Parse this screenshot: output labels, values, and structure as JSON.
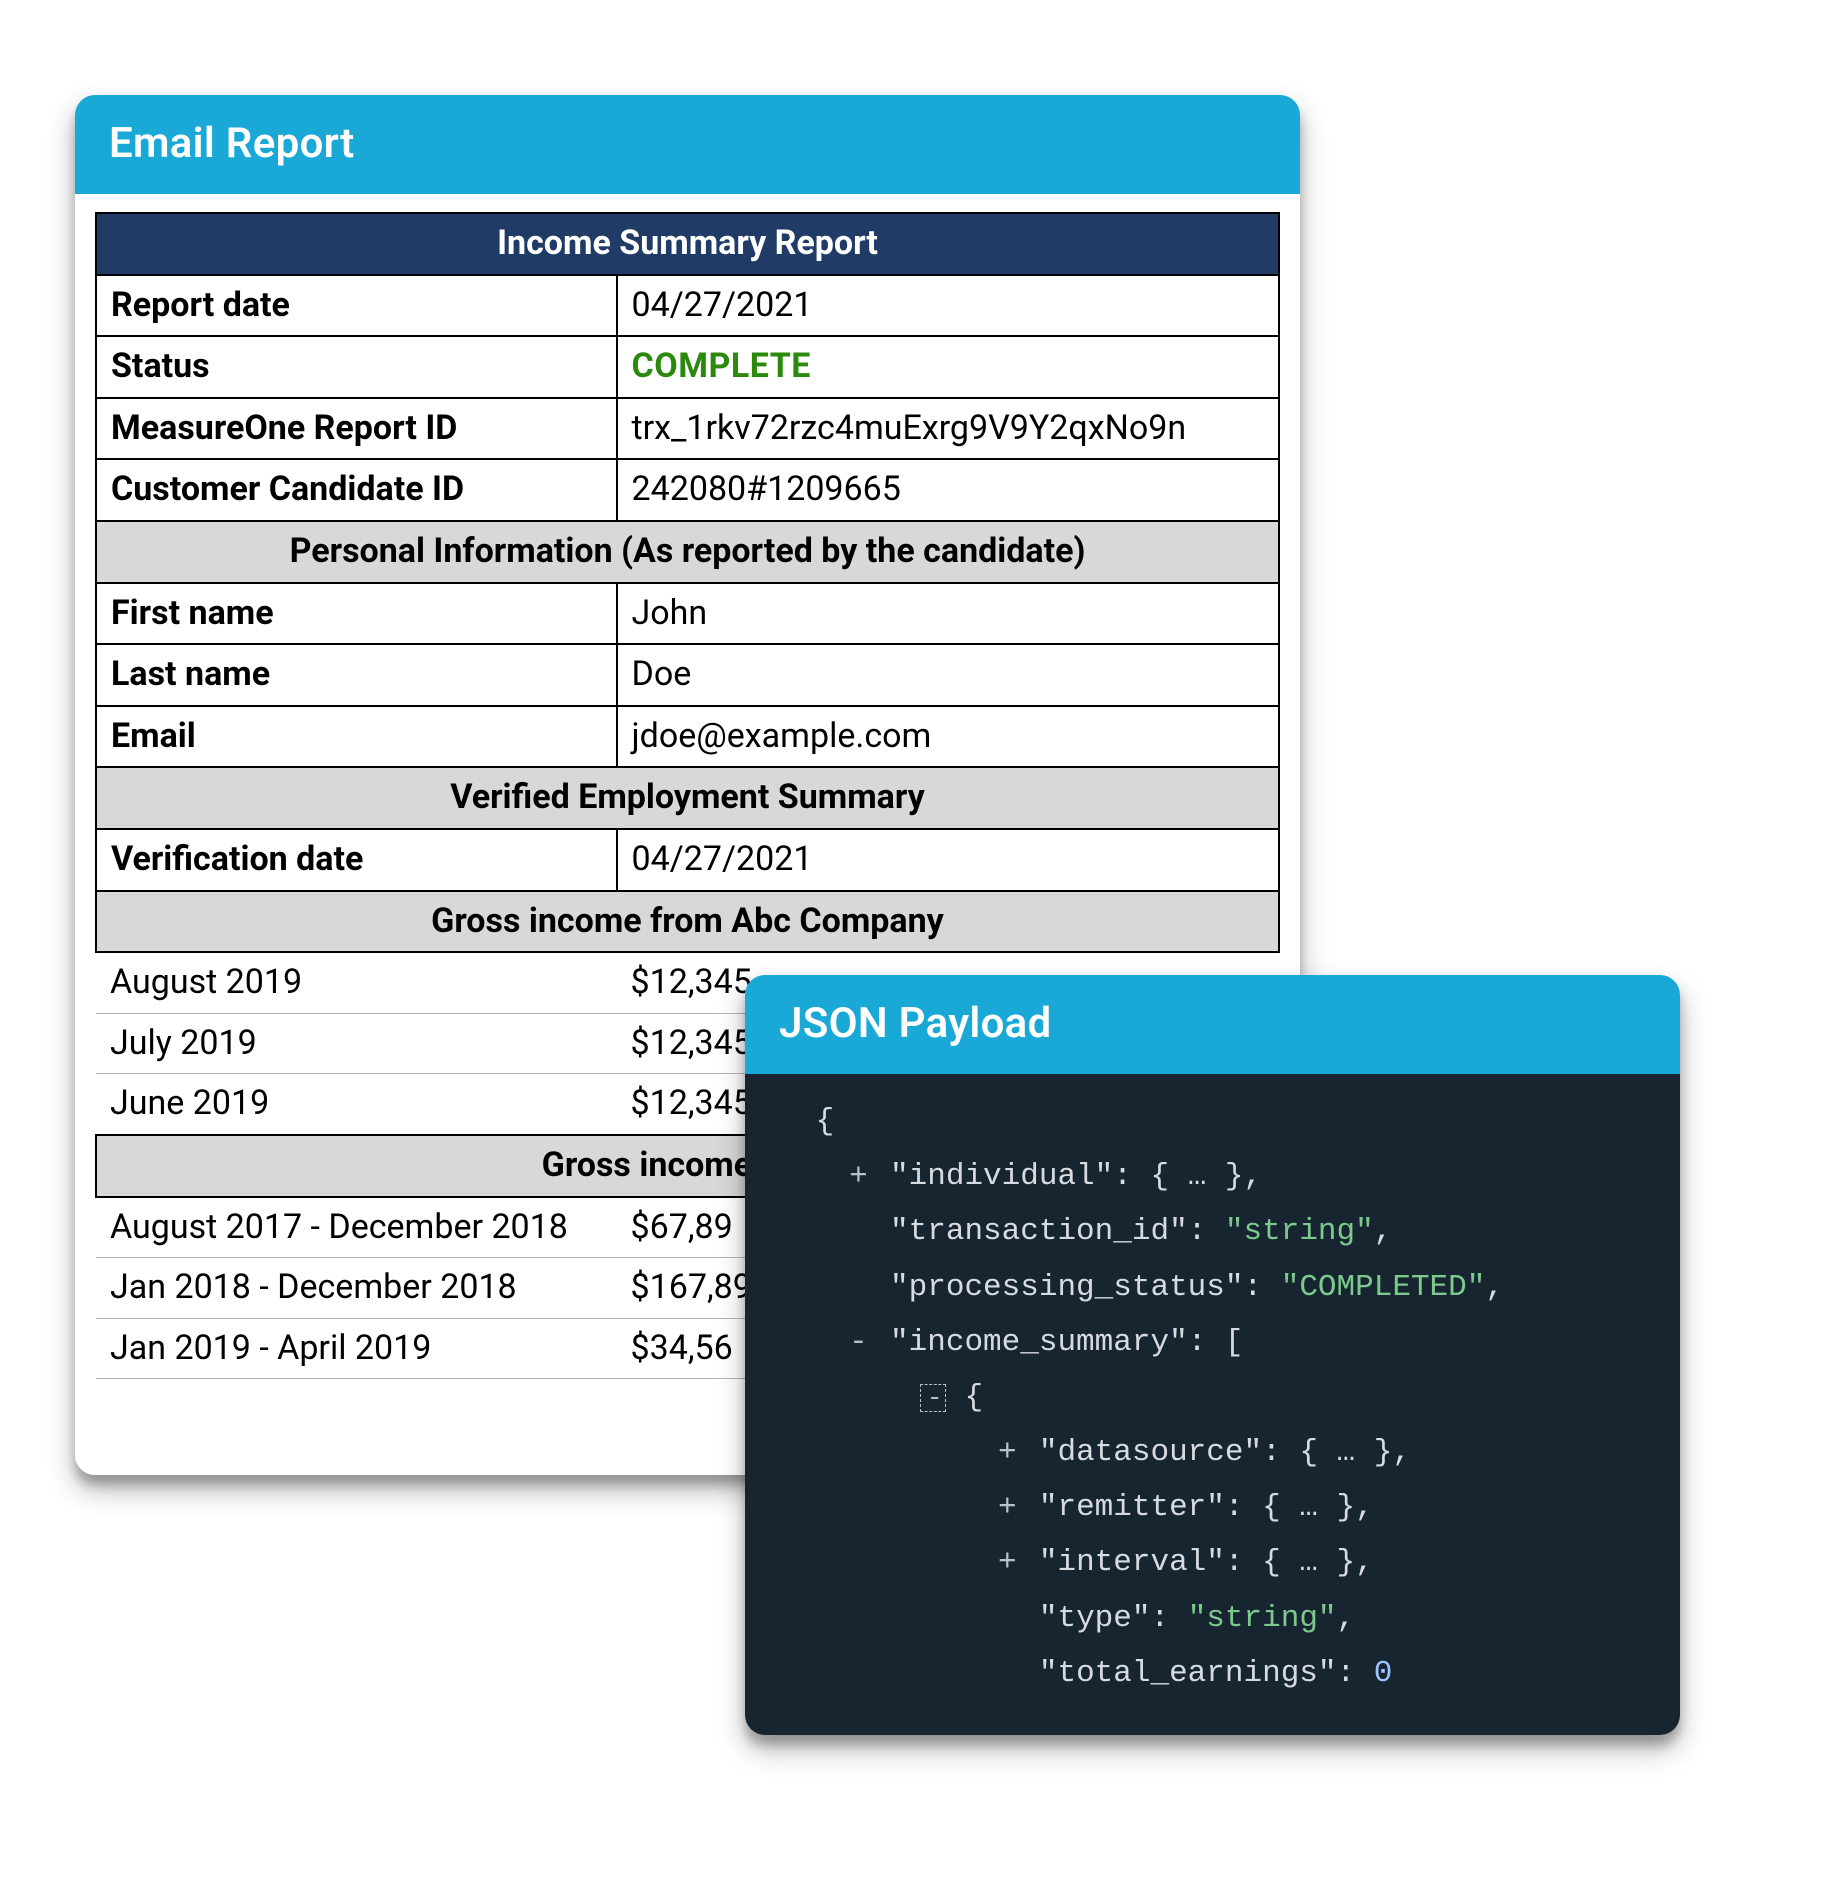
{
  "email_panel": {
    "title": "Email Report",
    "report_title": "Income Summary Report",
    "rows1": [
      {
        "label": "Report date",
        "value": "04/27/2021"
      },
      {
        "label": "Status",
        "value": "COMPLETE",
        "status": true
      },
      {
        "label": "MeasureOne Report ID",
        "value": "trx_1rkv72rzc4muExrg9V9Y2qxNo9n"
      },
      {
        "label": "Customer Candidate ID",
        "value": "242080#1209665"
      }
    ],
    "personal_title": "Personal Information (As reported by the candidate)",
    "rows2": [
      {
        "label": "First name",
        "value": "John"
      },
      {
        "label": "Last name",
        "value": "Doe"
      },
      {
        "label": "Email",
        "value": "jdoe@example.com"
      }
    ],
    "verified_title": "Verified Employment Summary",
    "rows3": [
      {
        "label": "Verification date",
        "value": "04/27/2021"
      }
    ],
    "gross1_title": "Gross income from Abc Company",
    "gross1_rows": [
      {
        "label": "August 2019",
        "value": "$12,345"
      },
      {
        "label": "July 2019",
        "value": "$12,345"
      },
      {
        "label": "June 2019",
        "value": "$12,345"
      }
    ],
    "gross2_title": "Gross income from",
    "gross2_rows": [
      {
        "label": "August 2017 - December 2018",
        "value": "$67,89"
      },
      {
        "label": "Jan 2018 - December 2018",
        "value": "$167,89"
      },
      {
        "label": "Jan 2019 - April 2019",
        "value": "$34,56"
      }
    ]
  },
  "json_panel": {
    "title": "JSON Payload",
    "lines": [
      {
        "indent": 0,
        "toggle": "",
        "content_html": "<span class='j-punc'>{</span>"
      },
      {
        "indent": 1,
        "toggle": "+",
        "content_html": "<span class='j-key'>\"individual\"</span><span class='j-punc'>: { … },</span>"
      },
      {
        "indent": 1,
        "toggle": "",
        "content_html": "<span class='j-key'>\"transaction_id\"</span><span class='j-punc'>: </span><span class='j-str'>\"string\"</span><span class='j-punc'>,</span>"
      },
      {
        "indent": 1,
        "toggle": "",
        "content_html": "<span class='j-key'>\"processing_status\"</span><span class='j-punc'>: </span><span class='j-str'>\"COMPLETED\"</span><span class='j-punc'>,</span>"
      },
      {
        "indent": 1,
        "toggle": "-",
        "content_html": "<span class='j-key'>\"income_summary\"</span><span class='j-punc'>: [</span>"
      },
      {
        "indent": 2,
        "toggle": "-",
        "boxed": true,
        "content_html": "<span class='j-punc'>{</span>"
      },
      {
        "indent": 3,
        "toggle": "+",
        "content_html": "<span class='j-key'>\"datasource\"</span><span class='j-punc'>: { … },</span>"
      },
      {
        "indent": 3,
        "toggle": "+",
        "content_html": "<span class='j-key'>\"remitter\"</span><span class='j-punc'>: { … },</span>"
      },
      {
        "indent": 3,
        "toggle": "+",
        "content_html": "<span class='j-key'>\"interval\"</span><span class='j-punc'>: { … },</span>"
      },
      {
        "indent": 3,
        "toggle": "",
        "content_html": "<span class='j-key'>\"type\"</span><span class='j-punc'>: </span><span class='j-str'>\"string\"</span><span class='j-punc'>,</span>"
      },
      {
        "indent": 3,
        "toggle": "",
        "content_html": "<span class='j-key'>\"total_earnings\"</span><span class='j-punc'>: </span><span class='j-num'>0</span>"
      }
    ]
  }
}
